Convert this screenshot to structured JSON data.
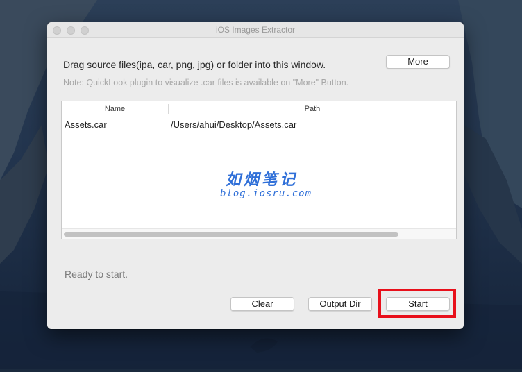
{
  "window": {
    "title": "iOS Images Extractor"
  },
  "header": {
    "instructions": "Drag source files(ipa, car, png, jpg) or folder into this window.",
    "note": "Note: QuickLook plugin to visualize .car files is available on \"More\" Button.",
    "more_label": "More"
  },
  "table": {
    "columns": [
      "Name",
      "Path"
    ],
    "rows": [
      {
        "name": "Assets.car",
        "path": "/Users/ahui/Desktop/Assets.car"
      }
    ]
  },
  "watermark": {
    "chinese": "如烟笔记",
    "url": "blog.iosru.com"
  },
  "status": {
    "text": "Ready to start."
  },
  "footer": {
    "clear_label": "Clear",
    "output_label": "Output Dir",
    "start_label": "Start"
  },
  "colors": {
    "highlight": "#e8101b",
    "watermark": "#2f6fd8"
  }
}
